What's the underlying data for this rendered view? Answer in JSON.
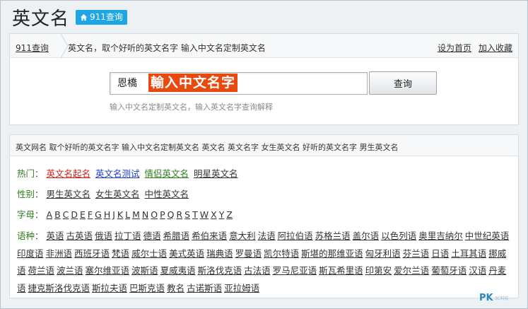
{
  "header": {
    "title": "英文名",
    "badge_label": "911查询"
  },
  "breadcrumb": {
    "home": "911查询",
    "text": "英文名，取个好听的英文名字 输入中文名定制英文名",
    "set_home": "设为首页",
    "favorite": "加入收藏"
  },
  "search": {
    "value": "恩橋",
    "overlay": "輸入中文名字",
    "button": "查询",
    "hint": "输入中文名定制英文名，输入英文名字查询解释"
  },
  "links": {
    "tagline": "英文网名 取个好听的英文名字 输入中文名定制英文名 英文名 英文名字 女生英文名 好听的英文名字 男生英文名",
    "hot": {
      "label": "热门：",
      "items": [
        "英文名起名",
        "英文名测试",
        "情侣英文名",
        "明星英文名"
      ]
    },
    "gender": {
      "label": "性别：",
      "items": [
        "男生英文名",
        "女生英文名",
        "中性英文名"
      ]
    },
    "letters": {
      "label": "字母：",
      "items": [
        "A",
        "B",
        "C",
        "D",
        "E",
        "F",
        "G",
        "H",
        "J",
        "K",
        "L",
        "M",
        "N",
        "O",
        "P",
        "Q",
        "R",
        "S",
        "T",
        "W",
        "X",
        "Y",
        "Z"
      ]
    },
    "languages": {
      "label": "语种：",
      "items": [
        "英语",
        "古英语",
        "俄语",
        "拉丁语",
        "德语",
        "希腊语",
        "希伯来语",
        "意大利",
        "法语",
        "阿拉伯语",
        "苏格兰语",
        "盖尔语",
        "以色列语",
        "奥里吉纳尔",
        "中世纪英语",
        "印度语",
        "非洲语",
        "西班牙语",
        "梵语",
        "威尔士语",
        "美式英语",
        "瑞典语",
        "罗曼语",
        "凯尔特语",
        "斯堪的那维亚语",
        "匈牙利语",
        "芬兰语",
        "日语",
        "土耳其语",
        "挪威语",
        "荷兰语",
        "波兰语",
        "塞尔维亚语",
        "波斯语",
        "夏威夷语",
        "斯洛伐克语",
        "古法语",
        "罗马尼亚语",
        "斯瓦希里语",
        "印第安",
        "爱尔兰语",
        "葡萄牙语",
        "汉语",
        "丹麦语",
        "捷克斯洛伐克语",
        "斯拉夫语",
        "巴斯克语",
        "教名",
        "古诺斯语",
        "亚拉姆语"
      ]
    }
  },
  "watermark": {
    "logo": "PK",
    "sub": "3C科技"
  },
  "colors": {
    "badge": "#1ea5e6",
    "overlay": "#e7490e",
    "label_green": "#2f7d1f"
  }
}
